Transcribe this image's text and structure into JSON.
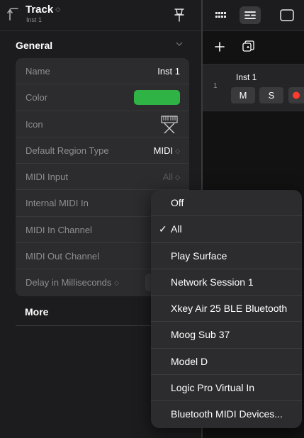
{
  "inspector": {
    "title": "Track",
    "subtitle": "Inst 1",
    "general_section": "General",
    "more_section": "More",
    "rows": [
      {
        "label": "Name",
        "value": "Inst 1"
      },
      {
        "label": "Color",
        "color": "#2fb344"
      },
      {
        "label": "Icon",
        "icon": "keyboard-icon"
      },
      {
        "label": "Default Region Type",
        "value": "MIDI"
      },
      {
        "label": "MIDI Input",
        "value": "All"
      },
      {
        "label": "Internal MIDI In"
      },
      {
        "label": "MIDI In Channel"
      },
      {
        "label": "MIDI Out Channel"
      },
      {
        "label": "Delay in Milliseconds"
      }
    ]
  },
  "toolbar": {
    "icons": [
      "grid-icon",
      "list-icon",
      "window-icon",
      "plus-icon",
      "duplicate-icon"
    ]
  },
  "track": {
    "number": "1",
    "name": "Inst 1",
    "mute_label": "M",
    "solo_label": "S"
  },
  "midi_input_menu": {
    "selected": "All",
    "items": [
      "Off",
      "All",
      "Play Surface",
      "Network Session 1",
      "Xkey Air 25 BLE Bluetooth",
      "Moog Sub 37",
      "Model D",
      "Logic Pro Virtual In",
      "Bluetooth MIDI Devices..."
    ]
  },
  "colors": {
    "background": "#1c1c1e",
    "row_background": "#2c2c2e",
    "secondary_text": "#8e8e93",
    "track_color": "#2fb344",
    "record": "#ff3b30"
  }
}
